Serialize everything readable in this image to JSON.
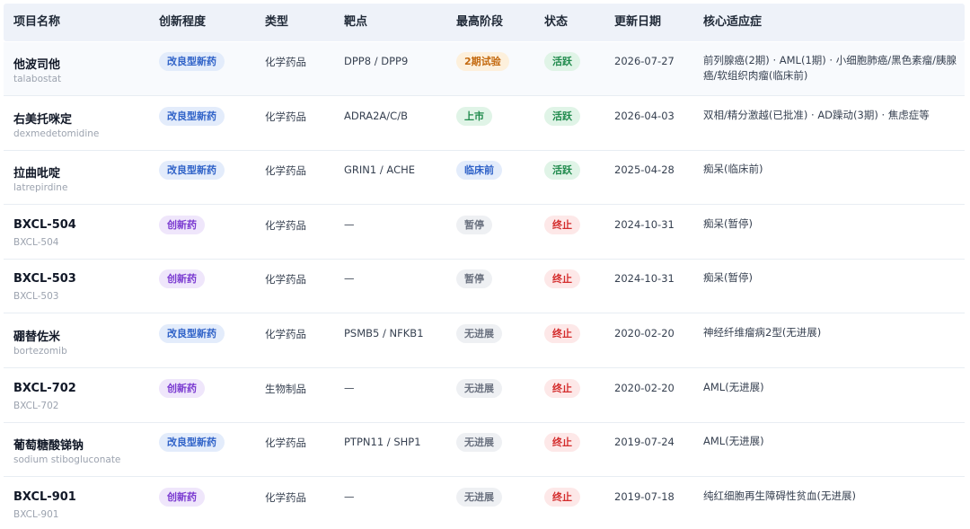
{
  "columns": [
    "项目名称",
    "创新程度",
    "类型",
    "靶点",
    "最高阶段",
    "状态",
    "更新日期",
    "核心适应症"
  ],
  "rows": [
    {
      "name": "他波司他",
      "sub": "talabostat",
      "innovation": "改良型新药",
      "innovation_kind": "blue",
      "type": "化学药品",
      "target": "DPP8 / DPP9",
      "stage": "2期试验",
      "stage_kind": "orange",
      "status": "活跃",
      "status_kind": "green",
      "date": "2026-07-27",
      "indication": "前列腺癌(2期) · AML(1期) · 小细胞肺癌/黑色素瘤/胰腺癌/软组织肉瘤(临床前)"
    },
    {
      "name": "右美托咪定",
      "sub": "dexmedetomidine",
      "innovation": "改良型新药",
      "innovation_kind": "blue",
      "type": "化学药品",
      "target": "ADRA2A/C/B",
      "stage": "上市",
      "stage_kind": "green",
      "status": "活跃",
      "status_kind": "green",
      "date": "2026-04-03",
      "indication": "双相/精分激越(已批准) · AD躁动(3期) · 焦虑症等"
    },
    {
      "name": "拉曲吡啶",
      "sub": "latrepirdine",
      "innovation": "改良型新药",
      "innovation_kind": "blue",
      "type": "化学药品",
      "target": "GRIN1 / ACHE",
      "stage": "临床前",
      "stage_kind": "blue",
      "status": "活跃",
      "status_kind": "green",
      "date": "2025-04-28",
      "indication": "痴呆(临床前)"
    },
    {
      "name": "BXCL-504",
      "sub": "BXCL-504",
      "innovation": "创新药",
      "innovation_kind": "purple",
      "type": "化学药品",
      "target": "—",
      "stage": "暂停",
      "stage_kind": "gray",
      "status": "终止",
      "status_kind": "red",
      "date": "2024-10-31",
      "indication": "痴呆(暂停)"
    },
    {
      "name": "BXCL-503",
      "sub": "BXCL-503",
      "innovation": "创新药",
      "innovation_kind": "purple",
      "type": "化学药品",
      "target": "—",
      "stage": "暂停",
      "stage_kind": "gray",
      "status": "终止",
      "status_kind": "red",
      "date": "2024-10-31",
      "indication": "痴呆(暂停)"
    },
    {
      "name": "硼替佐米",
      "sub": "bortezomib",
      "innovation": "改良型新药",
      "innovation_kind": "blue",
      "type": "化学药品",
      "target": "PSMB5 / NFKB1",
      "stage": "无进展",
      "stage_kind": "gray",
      "status": "终止",
      "status_kind": "red",
      "date": "2020-02-20",
      "indication": "神经纤维瘤病2型(无进展)"
    },
    {
      "name": "BXCL-702",
      "sub": "BXCL-702",
      "innovation": "创新药",
      "innovation_kind": "purple",
      "type": "生物制品",
      "target": "—",
      "stage": "无进展",
      "stage_kind": "gray",
      "status": "终止",
      "status_kind": "red",
      "date": "2020-02-20",
      "indication": "AML(无进展)"
    },
    {
      "name": "葡萄糖酸锑钠",
      "sub": "sodium stibogluconate",
      "innovation": "改良型新药",
      "innovation_kind": "blue",
      "type": "化学药品",
      "target": "PTPN11 / SHP1",
      "stage": "无进展",
      "stage_kind": "gray",
      "status": "终止",
      "status_kind": "red",
      "date": "2019-07-24",
      "indication": "AML(无进展)"
    },
    {
      "name": "BXCL-901",
      "sub": "BXCL-901",
      "innovation": "创新药",
      "innovation_kind": "purple",
      "type": "化学药品",
      "target": "—",
      "stage": "无进展",
      "stage_kind": "gray",
      "status": "终止",
      "status_kind": "red",
      "date": "2019-07-18",
      "indication": "纯红细胞再生障碍性贫血(无进展)"
    }
  ]
}
